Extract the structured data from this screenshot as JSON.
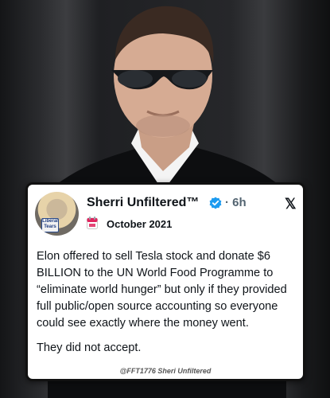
{
  "post": {
    "author_name": "Sherri Unfiltered™",
    "separator": "·",
    "time_ago": "6h",
    "date_label": "October 2021",
    "paragraphs": [
      "Elon offered to sell Tesla stock and donate $6 BILLION to the UN World Food Programme to “eliminate world hunger” but only if they provided full public/open source accounting so everyone could see exactly where the money went.",
      "They did not accept."
    ],
    "credit": "@FFT1776 Sheri Unfiltered",
    "avatar_mug_text": "Liberal Tears"
  },
  "icons": {
    "verified": "verified-badge-icon",
    "platform": "x-logo-icon",
    "date": "calendar-icon"
  },
  "colors": {
    "verified_blue": "#1d9bf0",
    "calendar_red": "#e0245e",
    "text": "#0f1419",
    "muted": "#536471"
  }
}
